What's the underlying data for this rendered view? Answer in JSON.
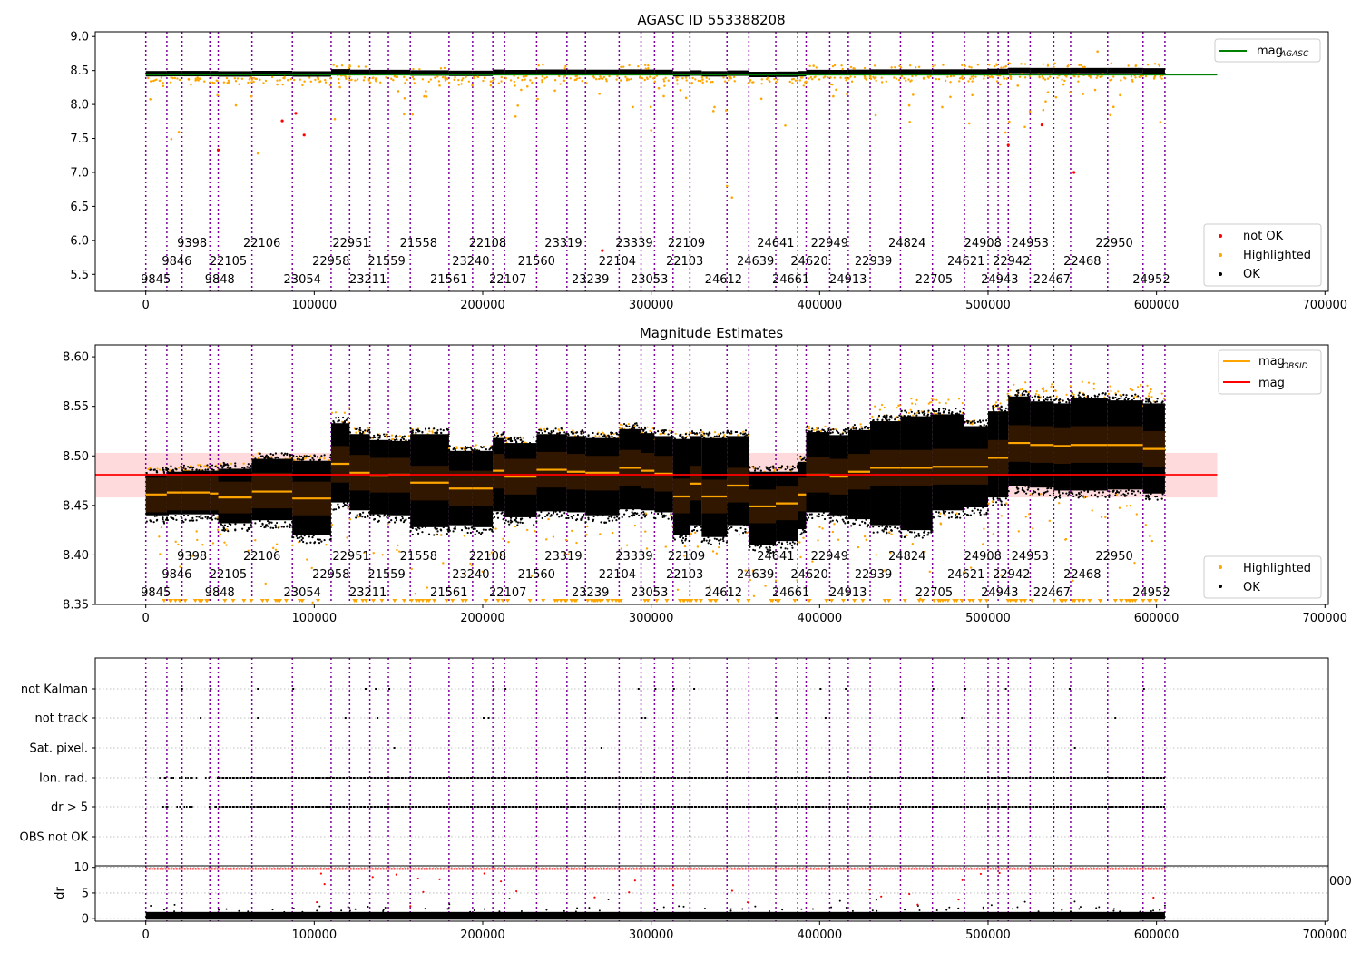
{
  "chart_data": [
    {
      "type": "scatter",
      "title": "AGASC ID 553388208",
      "xlim": [
        -30000,
        702000
      ],
      "ylim": [
        5.25,
        9.07
      ],
      "xticks": [
        0,
        100000,
        200000,
        300000,
        400000,
        500000,
        600000,
        700000
      ],
      "xtick_labels": [
        "0",
        "100000",
        "200000",
        "300000",
        "400000",
        "500000",
        "600000",
        "700000"
      ],
      "yticks": [
        5.5,
        6.0,
        6.5,
        7.0,
        7.5,
        8.0,
        8.5,
        9.0
      ],
      "ytick_labels": [
        "5.5",
        "6.0",
        "6.5",
        "7.0",
        "7.5",
        "8.0",
        "8.5",
        "9.0"
      ],
      "mag_agasc": 8.44,
      "line_x_range": [
        0,
        636000
      ],
      "legend_upper": [
        {
          "label": "mag",
          "subscript": "AGASC",
          "color": "#008000"
        }
      ],
      "legend_lower": [
        {
          "label": "not OK",
          "color": "#ff0000"
        },
        {
          "label": "Highlighted",
          "color": "#ffa500"
        },
        {
          "label": "OK",
          "color": "#000000"
        }
      ],
      "outliers_not_ok": [
        [
          43000,
          7.33
        ],
        [
          81000,
          7.76
        ],
        [
          89000,
          7.87
        ],
        [
          94000,
          7.55
        ],
        [
          271000,
          5.85
        ],
        [
          512000,
          7.4
        ],
        [
          532000,
          7.7
        ],
        [
          551000,
          7.0
        ]
      ]
    },
    {
      "type": "scatter",
      "title": "Magnitude Estimates",
      "xlim": [
        -30000,
        702000
      ],
      "ylim": [
        8.35,
        8.612
      ],
      "xticks": [
        0,
        100000,
        200000,
        300000,
        400000,
        500000,
        600000,
        700000
      ],
      "xtick_labels": [
        "0",
        "100000",
        "200000",
        "300000",
        "400000",
        "500000",
        "600000",
        "700000"
      ],
      "yticks": [
        8.35,
        8.4,
        8.45,
        8.5,
        8.55,
        8.6
      ],
      "ytick_labels": [
        "8.35",
        "8.40",
        "8.45",
        "8.50",
        "8.55",
        "8.60"
      ],
      "mag": 8.481,
      "mag_band": [
        8.458,
        8.503
      ],
      "legend_upper": [
        {
          "label": "mag",
          "subscript": "OBSID",
          "color": "#ffa500"
        },
        {
          "label": "mag",
          "subscript": "",
          "color": "#ff0000"
        }
      ],
      "legend_lower": [
        {
          "label": "Highlighted",
          "color": "#ffa500"
        },
        {
          "label": "OK",
          "color": "#000000"
        }
      ],
      "segments": [
        {
          "x0": 0,
          "x1": 12500,
          "med": 8.461,
          "lo": 8.443,
          "hi": 8.478,
          "top": 8.482,
          "bot": 8.44
        },
        {
          "x0": 12500,
          "x1": 21500,
          "med": 8.463,
          "lo": 8.445,
          "hi": 8.48,
          "top": 8.484,
          "bot": 8.441
        },
        {
          "x0": 21500,
          "x1": 38000,
          "med": 8.463,
          "lo": 8.445,
          "hi": 8.48,
          "top": 8.485,
          "bot": 8.441
        },
        {
          "x0": 38000,
          "x1": 43000,
          "med": 8.462,
          "lo": 8.445,
          "hi": 8.48,
          "top": 8.485,
          "bot": 8.441
        },
        {
          "x0": 43000,
          "x1": 63000,
          "med": 8.458,
          "lo": 8.442,
          "hi": 8.474,
          "top": 8.487,
          "bot": 8.432
        },
        {
          "x0": 63000,
          "x1": 87000,
          "med": 8.464,
          "lo": 8.447,
          "hi": 8.483,
          "top": 8.497,
          "bot": 8.435
        },
        {
          "x0": 87000,
          "x1": 110000,
          "med": 8.457,
          "lo": 8.44,
          "hi": 8.474,
          "top": 8.495,
          "bot": 8.42
        },
        {
          "x0": 110000,
          "x1": 121000,
          "med": 8.492,
          "lo": 8.473,
          "hi": 8.51,
          "top": 8.533,
          "bot": 8.453
        },
        {
          "x0": 121000,
          "x1": 133000,
          "med": 8.483,
          "lo": 8.465,
          "hi": 8.501,
          "top": 8.522,
          "bot": 8.445
        },
        {
          "x0": 133000,
          "x1": 144000,
          "med": 8.48,
          "lo": 8.463,
          "hi": 8.498,
          "top": 8.516,
          "bot": 8.441
        },
        {
          "x0": 144000,
          "x1": 157000,
          "med": 8.481,
          "lo": 8.463,
          "hi": 8.498,
          "top": 8.515,
          "bot": 8.44
        },
        {
          "x0": 157000,
          "x1": 180000,
          "med": 8.473,
          "lo": 8.455,
          "hi": 8.49,
          "top": 8.522,
          "bot": 8.428
        },
        {
          "x0": 180000,
          "x1": 194000,
          "med": 8.467,
          "lo": 8.449,
          "hi": 8.485,
          "top": 8.505,
          "bot": 8.43
        },
        {
          "x0": 194000,
          "x1": 206000,
          "med": 8.467,
          "lo": 8.449,
          "hi": 8.485,
          "top": 8.505,
          "bot": 8.428
        },
        {
          "x0": 206000,
          "x1": 213000,
          "med": 8.485,
          "lo": 8.467,
          "hi": 8.502,
          "top": 8.518,
          "bot": 8.444
        },
        {
          "x0": 213000,
          "x1": 232000,
          "med": 8.479,
          "lo": 8.461,
          "hi": 8.497,
          "top": 8.513,
          "bot": 8.438
        },
        {
          "x0": 232000,
          "x1": 250000,
          "med": 8.486,
          "lo": 8.468,
          "hi": 8.504,
          "top": 8.522,
          "bot": 8.444
        },
        {
          "x0": 250000,
          "x1": 261000,
          "med": 8.484,
          "lo": 8.466,
          "hi": 8.502,
          "top": 8.52,
          "bot": 8.443
        },
        {
          "x0": 261000,
          "x1": 281000,
          "med": 8.483,
          "lo": 8.465,
          "hi": 8.5,
          "top": 8.518,
          "bot": 8.44
        },
        {
          "x0": 281000,
          "x1": 294000,
          "med": 8.488,
          "lo": 8.47,
          "hi": 8.506,
          "top": 8.527,
          "bot": 8.446
        },
        {
          "x0": 294000,
          "x1": 302000,
          "med": 8.485,
          "lo": 8.467,
          "hi": 8.503,
          "top": 8.523,
          "bot": 8.445
        },
        {
          "x0": 302000,
          "x1": 313000,
          "med": 8.482,
          "lo": 8.464,
          "hi": 8.5,
          "top": 8.52,
          "bot": 8.443
        },
        {
          "x0": 313000,
          "x1": 323000,
          "med": 8.459,
          "lo": 8.442,
          "hi": 8.477,
          "top": 8.517,
          "bot": 8.42
        },
        {
          "x0": 323000,
          "x1": 330000,
          "med": 8.472,
          "lo": 8.455,
          "hi": 8.49,
          "top": 8.52,
          "bot": 8.43
        },
        {
          "x0": 330000,
          "x1": 345000,
          "med": 8.459,
          "lo": 8.442,
          "hi": 8.476,
          "top": 8.518,
          "bot": 8.418
        },
        {
          "x0": 345000,
          "x1": 358000,
          "med": 8.47,
          "lo": 8.453,
          "hi": 8.488,
          "top": 8.52,
          "bot": 8.43
        },
        {
          "x0": 358000,
          "x1": 374000,
          "med": 8.449,
          "lo": 8.432,
          "hi": 8.466,
          "top": 8.484,
          "bot": 8.41
        },
        {
          "x0": 374000,
          "x1": 387000,
          "med": 8.452,
          "lo": 8.435,
          "hi": 8.469,
          "top": 8.484,
          "bot": 8.414
        },
        {
          "x0": 387000,
          "x1": 392000,
          "med": 8.461,
          "lo": 8.444,
          "hi": 8.478,
          "top": 8.494,
          "bot": 8.426
        },
        {
          "x0": 392000,
          "x1": 406000,
          "med": 8.481,
          "lo": 8.463,
          "hi": 8.499,
          "top": 8.524,
          "bot": 8.443
        },
        {
          "x0": 406000,
          "x1": 417000,
          "med": 8.479,
          "lo": 8.461,
          "hi": 8.497,
          "top": 8.521,
          "bot": 8.44
        },
        {
          "x0": 417000,
          "x1": 430000,
          "med": 8.484,
          "lo": 8.466,
          "hi": 8.502,
          "top": 8.526,
          "bot": 8.436
        },
        {
          "x0": 430000,
          "x1": 448000,
          "med": 8.488,
          "lo": 8.47,
          "hi": 8.506,
          "top": 8.535,
          "bot": 8.43
        },
        {
          "x0": 448000,
          "x1": 467000,
          "med": 8.488,
          "lo": 8.47,
          "hi": 8.506,
          "top": 8.54,
          "bot": 8.425
        },
        {
          "x0": 467000,
          "x1": 486000,
          "med": 8.489,
          "lo": 8.471,
          "hi": 8.507,
          "top": 8.542,
          "bot": 8.445
        },
        {
          "x0": 486000,
          "x1": 500000,
          "med": 8.489,
          "lo": 8.471,
          "hi": 8.507,
          "top": 8.53,
          "bot": 8.448
        },
        {
          "x0": 500000,
          "x1": 506000,
          "med": 8.498,
          "lo": 8.48,
          "hi": 8.516,
          "top": 8.545,
          "bot": 8.458
        },
        {
          "x0": 506000,
          "x1": 512000,
          "med": 8.498,
          "lo": 8.48,
          "hi": 8.516,
          "top": 8.545,
          "bot": 8.458
        },
        {
          "x0": 512000,
          "x1": 525000,
          "med": 8.513,
          "lo": 8.494,
          "hi": 8.531,
          "top": 8.56,
          "bot": 8.47
        },
        {
          "x0": 525000,
          "x1": 539000,
          "med": 8.511,
          "lo": 8.493,
          "hi": 8.53,
          "top": 8.555,
          "bot": 8.468
        },
        {
          "x0": 539000,
          "x1": 549000,
          "med": 8.51,
          "lo": 8.492,
          "hi": 8.528,
          "top": 8.553,
          "bot": 8.465
        },
        {
          "x0": 549000,
          "x1": 571000,
          "med": 8.511,
          "lo": 8.493,
          "hi": 8.53,
          "top": 8.558,
          "bot": 8.465
        },
        {
          "x0": 571000,
          "x1": 592000,
          "med": 8.511,
          "lo": 8.493,
          "hi": 8.53,
          "top": 8.556,
          "bot": 8.466
        },
        {
          "x0": 592000,
          "x1": 605000,
          "med": 8.507,
          "lo": 8.489,
          "hi": 8.525,
          "top": 8.553,
          "bot": 8.462
        }
      ]
    },
    {
      "type": "scatter",
      "title": "",
      "xlim": [
        -30000,
        702000
      ],
      "xticks": [
        0,
        100000,
        200000,
        300000,
        400000,
        500000,
        600000,
        700000
      ],
      "xtick_labels": [
        "0",
        "100000",
        "200000",
        "300000",
        "400000",
        "500000",
        "600000",
        "700000"
      ],
      "flag_categories": [
        "not Kalman",
        "not track",
        "Sat. pixel.",
        "Ion. rad.",
        "dr > 5",
        "OBS not OK"
      ],
      "dr_ylabel": "dr",
      "dr_yticks": [
        0,
        5,
        10
      ],
      "dr_ytick_labels": [
        "0",
        "5",
        "10"
      ],
      "dr_ylim": [
        -0.5,
        10.3
      ],
      "dr_clip": 9.7,
      "stray_label": "000"
    }
  ],
  "obsid_boundaries": [
    0,
    12500,
    21500,
    38000,
    43000,
    63000,
    87000,
    110000,
    121000,
    133000,
    144000,
    157000,
    180000,
    194000,
    206000,
    213000,
    232000,
    250000,
    261000,
    281000,
    294000,
    302000,
    313000,
    323000,
    345000,
    358000,
    374000,
    387000,
    392000,
    406000,
    417000,
    430000,
    448000,
    467000,
    486000,
    500000,
    506000,
    512000,
    525000,
    539000,
    549000,
    571000,
    592000,
    605000
  ],
  "obsid_labels": [
    {
      "text": "9845",
      "x": 0,
      "row": 2
    },
    {
      "text": "9846",
      "x": 12500,
      "row": 1
    },
    {
      "text": "9398",
      "x": 21500,
      "row": 0
    },
    {
      "text": "9848",
      "x": 38000,
      "row": 2
    },
    {
      "text": "22105",
      "x": 43000,
      "row": 1
    },
    {
      "text": "22106",
      "x": 63000,
      "row": 0
    },
    {
      "text": "23054",
      "x": 87000,
      "row": 2
    },
    {
      "text": "22958",
      "x": 104000,
      "row": 1
    },
    {
      "text": "22951",
      "x": 116000,
      "row": 0
    },
    {
      "text": "23211",
      "x": 126000,
      "row": 2
    },
    {
      "text": "21559",
      "x": 137000,
      "row": 1
    },
    {
      "text": "21558",
      "x": 156000,
      "row": 0
    },
    {
      "text": "21561",
      "x": 174000,
      "row": 2
    },
    {
      "text": "23240",
      "x": 187000,
      "row": 1
    },
    {
      "text": "22108",
      "x": 197000,
      "row": 0
    },
    {
      "text": "22107",
      "x": 209000,
      "row": 2
    },
    {
      "text": "21560",
      "x": 226000,
      "row": 1
    },
    {
      "text": "23319",
      "x": 242000,
      "row": 0
    },
    {
      "text": "23239",
      "x": 258000,
      "row": 2
    },
    {
      "text": "22104",
      "x": 274000,
      "row": 1
    },
    {
      "text": "23339",
      "x": 284000,
      "row": 0
    },
    {
      "text": "23053",
      "x": 293000,
      "row": 2
    },
    {
      "text": "22103",
      "x": 314000,
      "row": 1
    },
    {
      "text": "22109",
      "x": 315000,
      "row": 0
    },
    {
      "text": "24612",
      "x": 337000,
      "row": 2
    },
    {
      "text": "24639",
      "x": 356000,
      "row": 1
    },
    {
      "text": "24641",
      "x": 368000,
      "row": 0
    },
    {
      "text": "24661",
      "x": 377000,
      "row": 2
    },
    {
      "text": "24620",
      "x": 388000,
      "row": 1
    },
    {
      "text": "22949",
      "x": 400000,
      "row": 0
    },
    {
      "text": "24913",
      "x": 411000,
      "row": 2
    },
    {
      "text": "22939",
      "x": 426000,
      "row": 1
    },
    {
      "text": "24824",
      "x": 446000,
      "row": 0
    },
    {
      "text": "22705",
      "x": 462000,
      "row": 2
    },
    {
      "text": "24621",
      "x": 481000,
      "row": 1
    },
    {
      "text": "24908",
      "x": 491000,
      "row": 0
    },
    {
      "text": "24943",
      "x": 501000,
      "row": 2
    },
    {
      "text": "22942",
      "x": 508000,
      "row": 1
    },
    {
      "text": "24953",
      "x": 519000,
      "row": 0
    },
    {
      "text": "22467",
      "x": 532000,
      "row": 2
    },
    {
      "text": "22468",
      "x": 550000,
      "row": 1
    },
    {
      "text": "22950",
      "x": 569000,
      "row": 0
    },
    {
      "text": "24952",
      "x": 591000,
      "row": 2
    }
  ]
}
